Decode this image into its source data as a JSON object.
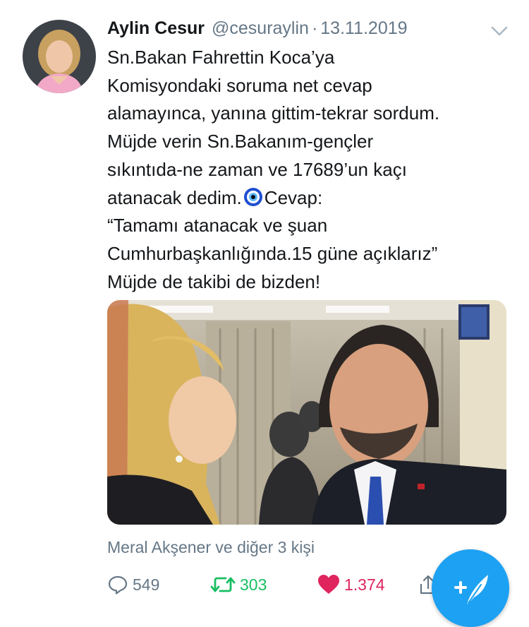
{
  "tweet": {
    "author_name": "Aylin Cesur",
    "handle": "@cesuraylin",
    "separator": "·",
    "date": "13.11.2019",
    "lines": [
      "Sn.Bakan Fahrettin Koca’ya",
      "Komisyondaki soruma net cevap",
      "alamayınca, yanına gittim-tekrar sordum.",
      "Müjde verin Sn.Bakanım-gençler",
      "sıkıntıda-ne zaman ve 17689’un kaçı"
    ],
    "line6_before_emoji": "atanacak dedim.",
    "line6_after_emoji": "Cevap:",
    "lines_after": [
      "“Tamamı atanacak ve şuan",
      "Cumhurbaşkanlığında.15 güne açıklarız”",
      "Müjde de takibi de bizden!"
    ],
    "emoji_name": "nazar-amulet-icon"
  },
  "likers": "Meral Akşener ve diğer 3 kişi",
  "actions": {
    "replies": "549",
    "retweets": "303",
    "likes": "1.374"
  },
  "colors": {
    "text": "#14171a",
    "secondary": "#657786",
    "retweet": "#17bf63",
    "like": "#e0245e",
    "accent": "#1da1f2"
  }
}
